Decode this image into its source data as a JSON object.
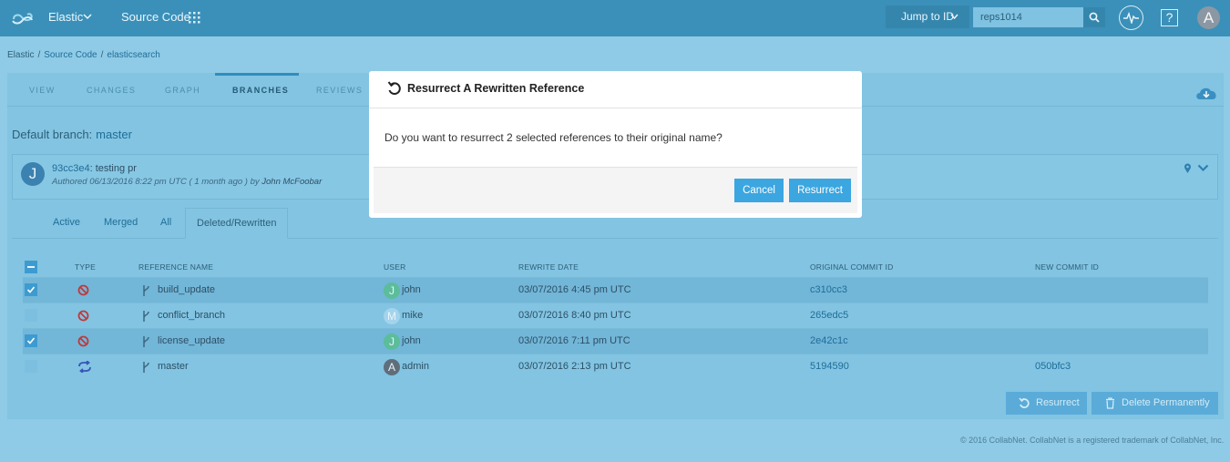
{
  "topbar": {
    "brand": "Elastic",
    "product": "Source Code",
    "jump_label": "Jump to ID",
    "search_value": "reps1014",
    "help_glyph": "?",
    "avatar_letter": "A"
  },
  "breadcrumb": [
    "Elastic",
    "Source Code",
    "elasticsearch"
  ],
  "tabs": [
    "VIEW",
    "CHANGES",
    "GRAPH",
    "BRANCHES",
    "REVIEWS"
  ],
  "active_tab": "BRANCHES",
  "default_branch": {
    "label": "Default branch:",
    "value": "master"
  },
  "commit": {
    "avatar_letter": "J",
    "hash": "93cc3e4",
    "message": ": testing pr",
    "authored": "Authored 06/13/2016 8:22 pm UTC ( 1 month ago ) by",
    "author": "John McFoobar"
  },
  "subtabs": [
    "Active",
    "Merged",
    "All",
    "Deleted/Rewritten"
  ],
  "active_subtab": "Deleted/Rewritten",
  "table": {
    "headers": [
      "TYPE",
      "REFERENCE NAME",
      "USER",
      "REWRITE DATE",
      "ORIGINAL COMMIT ID",
      "NEW COMMIT ID"
    ],
    "rows": [
      {
        "selected": true,
        "type": "deleted",
        "name": "build_update",
        "user_letter": "J",
        "user": "john",
        "date": "03/07/2016 4:45 pm UTC",
        "original": "c310cc3",
        "new": ""
      },
      {
        "selected": false,
        "type": "deleted",
        "name": "conflict_branch",
        "user_letter": "M",
        "user": "mike",
        "date": "03/07/2016 8:40 pm UTC",
        "original": "265edc5",
        "new": ""
      },
      {
        "selected": true,
        "type": "deleted",
        "name": "license_update",
        "user_letter": "J",
        "user": "john",
        "date": "03/07/2016 7:11 pm UTC",
        "original": "2e42c1c",
        "new": ""
      },
      {
        "selected": false,
        "type": "rewritten",
        "name": "master",
        "user_letter": "A",
        "user": "admin",
        "date": "03/07/2016 2:13 pm UTC",
        "original": "5194590",
        "new": "050bfc3"
      }
    ]
  },
  "actions": {
    "resurrect": "Resurrect",
    "delete": "Delete Permanently"
  },
  "footer": "© 2016 CollabNet. CollabNet is a registered trademark of CollabNet, Inc.",
  "modal": {
    "title": "Resurrect A Rewritten Reference",
    "body": "Do you want to resurrect 2 selected references to their original name?",
    "cancel": "Cancel",
    "confirm": "Resurrect"
  },
  "colors": {
    "accent": "#3ba6e0",
    "topbar": "#3b90b9",
    "panel": "#82c4e2",
    "deleted_icon": "#c0393b",
    "rewritten_icon": "#3a55b8"
  }
}
